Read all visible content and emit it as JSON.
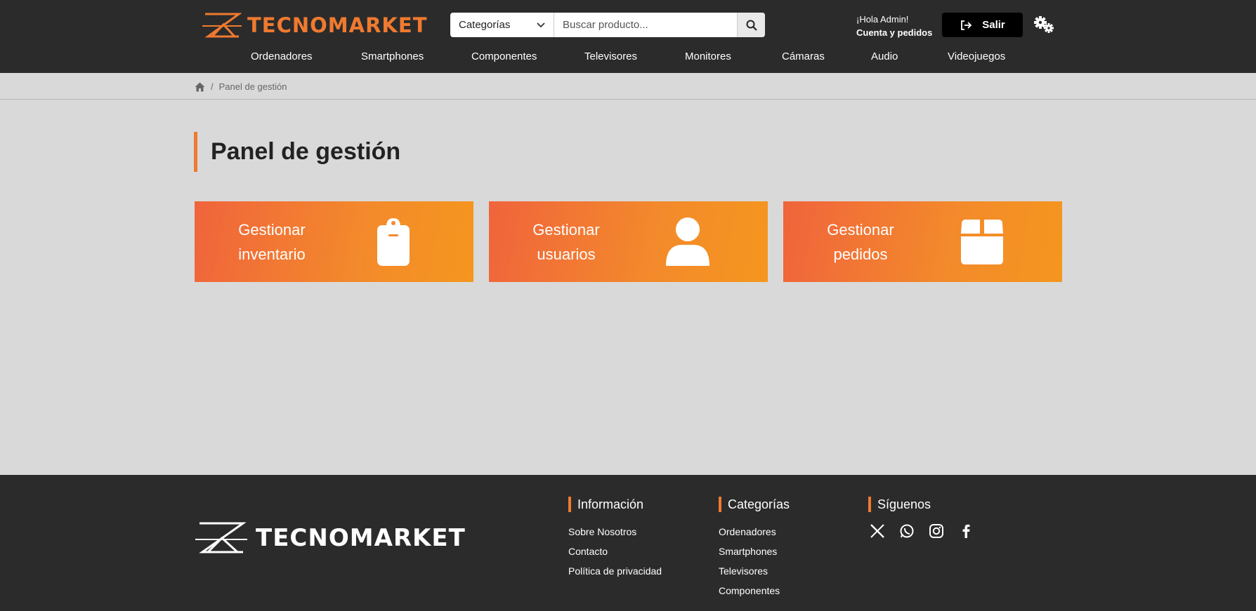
{
  "header": {
    "logo_text": "TECNOMARKET",
    "search": {
      "category_label": "Categorías",
      "placeholder": "Buscar producto..."
    },
    "greeting": "¡Hola Admin!",
    "account_link": "Cuenta y pedidos",
    "logout_label": "Salir"
  },
  "nav": {
    "items": [
      "Ordenadores",
      "Smartphones",
      "Componentes",
      "Televisores",
      "Monitores",
      "Cámaras",
      "Audio",
      "Videojuegos"
    ]
  },
  "breadcrumb": {
    "current": "Panel de gestión"
  },
  "main": {
    "title": "Panel de gestión",
    "cards": [
      {
        "line1": "Gestionar",
        "line2": "inventario",
        "icon": "clipboard-icon"
      },
      {
        "line1": "Gestionar",
        "line2": "usuarios",
        "icon": "user-icon"
      },
      {
        "line1": "Gestionar",
        "line2": "pedidos",
        "icon": "box-icon"
      }
    ]
  },
  "footer": {
    "logo_text": "TECNOMARKET",
    "info": {
      "heading": "Información",
      "links": [
        "Sobre Nosotros",
        "Contacto",
        "Política de privacidad"
      ]
    },
    "categories": {
      "heading": "Categorías",
      "links": [
        "Ordenadores",
        "Smartphones",
        "Televisores",
        "Componentes"
      ]
    },
    "social": {
      "heading": "Síguenos",
      "icons": [
        "x-icon",
        "whatsapp-icon",
        "instagram-icon",
        "facebook-icon"
      ]
    }
  },
  "colors": {
    "accent": "#f07a30",
    "header_bg": "#2b2b2b",
    "page_bg": "#d9d9d9"
  }
}
